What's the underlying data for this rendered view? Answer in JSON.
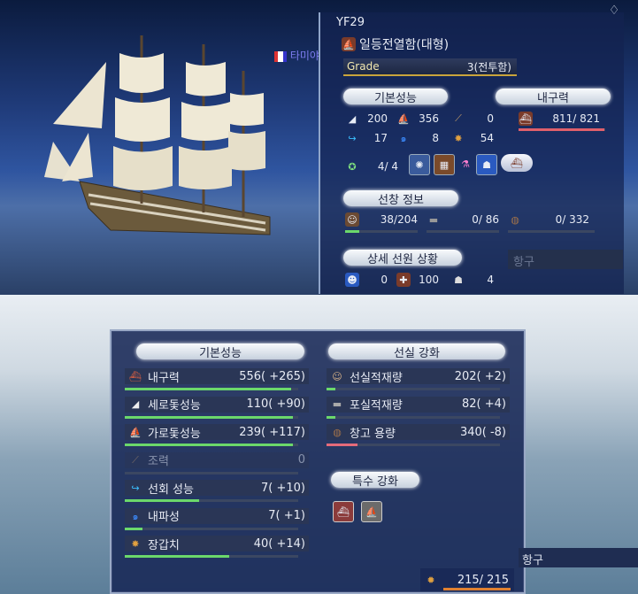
{
  "ship": {
    "name": "YF29",
    "class": "일등전열함(대형)",
    "grade_label": "Grade",
    "grade_value": "3(전투함)",
    "flag_text": "타미야"
  },
  "top_panel": {
    "basic_header": "기본성능",
    "durability_header": "내구력",
    "basic_stats": [
      {
        "icon": "vertical-sail-icon",
        "value": "200"
      },
      {
        "icon": "horizontal-sail-icon",
        "value": "356"
      },
      {
        "icon": "oar-icon",
        "value": "0"
      },
      {
        "icon": "turn-arrow-icon",
        "value": "17"
      },
      {
        "icon": "wave-icon",
        "value": "8"
      },
      {
        "icon": "armor-icon",
        "value": "54"
      }
    ],
    "durability_value": "811/ 821",
    "durability_fraction": 0.988,
    "equip_slots": "4/ 4",
    "crew_header": "선창 정보",
    "crew": [
      {
        "icon": "sailor-icon",
        "value": "38/204",
        "fraction": 0.19
      },
      {
        "icon": "cannon-icon",
        "value": "0/ 86",
        "fraction": 0
      },
      {
        "icon": "barrel-icon",
        "value": "0/ 332",
        "fraction": 0
      }
    ],
    "detail_header": "상세 선원 상황",
    "detail": [
      {
        "icon": "crew-face-icon",
        "value": "0"
      },
      {
        "icon": "crew-heal-icon",
        "value": "100"
      },
      {
        "icon": "crew-morale-icon",
        "value": "4"
      }
    ],
    "port_label": "항구"
  },
  "dialog": {
    "left_header": "기본성능",
    "right_header": "선실 강화",
    "special_header": "특수 강화",
    "left_rows": [
      {
        "icon": "hull-icon",
        "label": "내구력",
        "value": "556( +265)",
        "fraction": 0.96,
        "color": "#6bd86b"
      },
      {
        "icon": "vertical-sail-icon",
        "label": "세로돛성능",
        "value": "110( +90)",
        "fraction": 0.97,
        "color": "#6bd86b"
      },
      {
        "icon": "horizontal-sail-icon",
        "label": "가로돛성능",
        "value": "239( +117)",
        "fraction": 0.97,
        "color": "#6bd86b"
      },
      {
        "icon": "oar-icon",
        "label": "조력",
        "value": "0",
        "fraction": 0,
        "color": "#6bd86b",
        "dim": true
      },
      {
        "icon": "turn-arrow-icon",
        "label": "선회 성능",
        "value": "7( +10)",
        "fraction": 0.43,
        "color": "#6bd86b"
      },
      {
        "icon": "wave-icon",
        "label": "내파성",
        "value": "7( +1)",
        "fraction": 0.1,
        "color": "#6bd86b"
      },
      {
        "icon": "armor-icon",
        "label": "장갑치",
        "value": "40( +14)",
        "fraction": 0.6,
        "color": "#6bd86b"
      }
    ],
    "right_rows": [
      {
        "icon": "sailor-icon",
        "label": "선실적재량",
        "value": "202( +2)",
        "fraction": 0.05,
        "color": "#6bd86b"
      },
      {
        "icon": "cannon-icon",
        "label": "포실적재량",
        "value": "82( +4)",
        "fraction": 0.05,
        "color": "#6bd86b"
      },
      {
        "icon": "barrel-icon",
        "label": "창고 용량",
        "value": "340( -8)",
        "fraction": 0.18,
        "color": "#e56b7b"
      }
    ],
    "special_icons": [
      "hull-upgrade-icon",
      "sail-upgrade-icon"
    ]
  },
  "bottom_strip": {
    "port_label": "항구",
    "supply_value": "215/ 215",
    "supply_fraction": 1.0
  },
  "colors": {
    "durability_bar": "#e0606b",
    "green_bar": "#6bd86b"
  }
}
